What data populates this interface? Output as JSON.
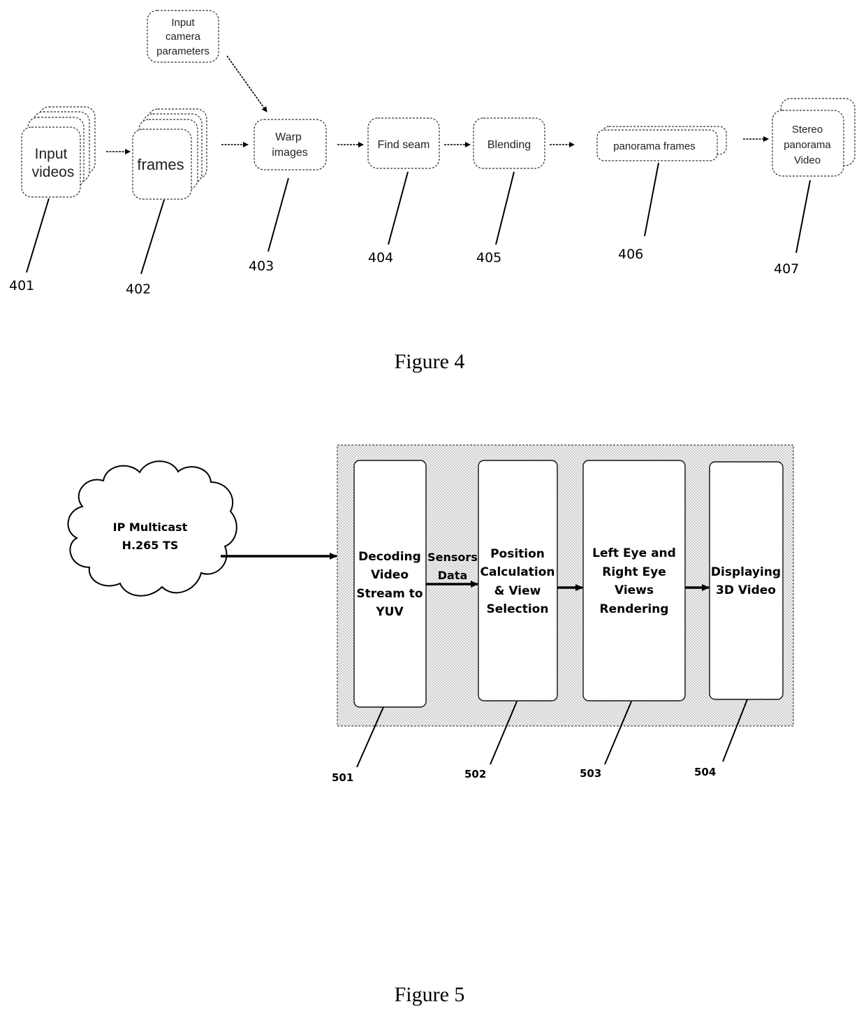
{
  "figure4": {
    "caption": "Figure 4",
    "nodes": {
      "camera_params": [
        "Input",
        "camera",
        "parameters"
      ],
      "input_videos": [
        "Input",
        "videos"
      ],
      "frames": [
        "frames"
      ],
      "warp_images": [
        "Warp",
        "images"
      ],
      "find_seam": [
        "Find seam"
      ],
      "blending": [
        "Blending"
      ],
      "panorama_frames": [
        "panorama frames"
      ],
      "stereo_video": [
        "Stereo",
        "panorama",
        "Video"
      ]
    },
    "refs": {
      "input_videos": "401",
      "frames": "402",
      "warp_images": "403",
      "find_seam": "404",
      "blending": "405",
      "panorama_frames": "406",
      "stereo_video": "407"
    }
  },
  "figure5": {
    "caption": "Figure 5",
    "cloud": [
      "IP Multicast",
      "H.265 TS"
    ],
    "blocks": {
      "decoding": [
        "Decoding",
        "Video",
        "Stream to",
        "YUV"
      ],
      "position": [
        "Position",
        "Calculation",
        "& View",
        "Selection"
      ],
      "rendering": [
        "Left Eye and",
        "Right Eye",
        "Views",
        "Rendering"
      ],
      "display": [
        "Displaying",
        "3D Video"
      ]
    },
    "sensors_label": [
      "Sensors",
      "Data"
    ],
    "refs": {
      "decoding": "501",
      "position": "502",
      "rendering": "503",
      "display": "504"
    }
  }
}
